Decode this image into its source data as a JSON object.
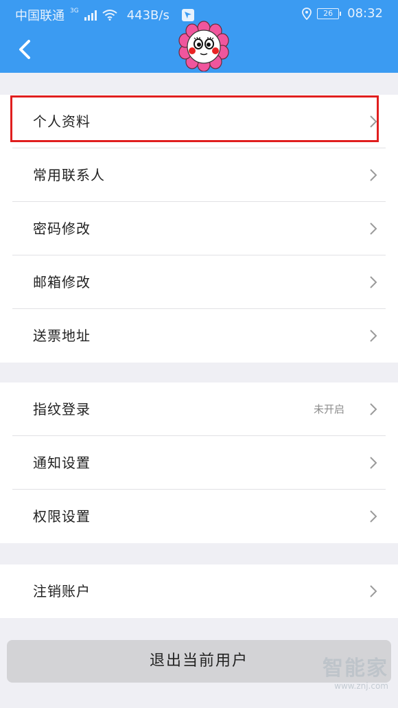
{
  "status_bar": {
    "carrier": "中国联通",
    "network": "3G",
    "speed": "443B/s",
    "battery": "26",
    "time": "08:32"
  },
  "header": {
    "back_icon": "chevron-left-icon",
    "avatar_icon": "flower-face-avatar"
  },
  "sections": [
    {
      "items": [
        {
          "label": "个人资料"
        },
        {
          "label": "常用联系人"
        },
        {
          "label": "密码修改"
        },
        {
          "label": "邮箱修改"
        },
        {
          "label": "送票地址"
        }
      ]
    },
    {
      "items": [
        {
          "label": "指纹登录",
          "value": "未开启"
        },
        {
          "label": "通知设置"
        },
        {
          "label": "权限设置"
        }
      ]
    },
    {
      "items": [
        {
          "label": "注销账户"
        }
      ]
    }
  ],
  "logout_button": "退出当前用户",
  "watermark": {
    "text": "智能家",
    "url": "www.znj.com"
  },
  "colors": {
    "header": "#3b9bf2",
    "background": "#efeff4",
    "highlight": "#e01e1e"
  }
}
